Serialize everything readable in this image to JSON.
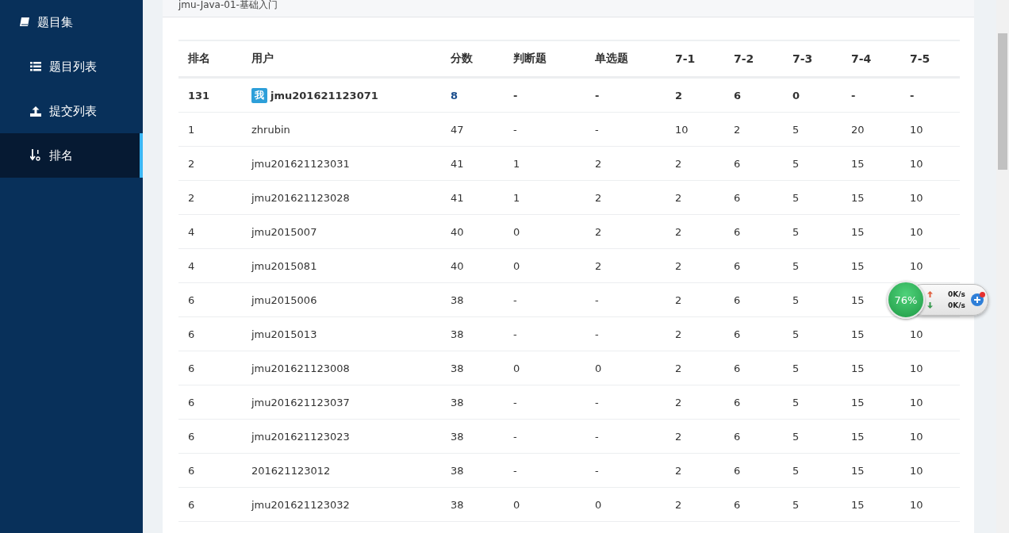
{
  "sidebar": {
    "title": "题目集",
    "items": [
      {
        "label": "题目列表",
        "kind": "list",
        "selected": false
      },
      {
        "label": "提交列表",
        "kind": "upload",
        "selected": false
      },
      {
        "label": "排名",
        "kind": "sort",
        "selected": true
      }
    ]
  },
  "page_title": "jmu-Java-01-基础入门",
  "table": {
    "columns": [
      "排名",
      "用户",
      "分数",
      "判断题",
      "单选题",
      "7-1",
      "7-2",
      "7-3",
      "7-4",
      "7-5"
    ],
    "rows": [
      {
        "self": true,
        "badge": "我",
        "cells": [
          "131",
          "jmu201621123071",
          "8",
          "-",
          "-",
          "2",
          "6",
          "0",
          "-",
          "-"
        ]
      },
      {
        "self": false,
        "cells": [
          "1",
          "zhrubin",
          "47",
          "-",
          "-",
          "10",
          "2",
          "5",
          "20",
          "10"
        ]
      },
      {
        "self": false,
        "cells": [
          "2",
          "jmu201621123031",
          "41",
          "1",
          "2",
          "2",
          "6",
          "5",
          "15",
          "10"
        ]
      },
      {
        "self": false,
        "cells": [
          "2",
          "jmu201621123028",
          "41",
          "1",
          "2",
          "2",
          "6",
          "5",
          "15",
          "10"
        ]
      },
      {
        "self": false,
        "cells": [
          "4",
          "jmu2015007",
          "40",
          "0",
          "2",
          "2",
          "6",
          "5",
          "15",
          "10"
        ]
      },
      {
        "self": false,
        "cells": [
          "4",
          "jmu2015081",
          "40",
          "0",
          "2",
          "2",
          "6",
          "5",
          "15",
          "10"
        ]
      },
      {
        "self": false,
        "cells": [
          "6",
          "jmu2015006",
          "38",
          "-",
          "-",
          "2",
          "6",
          "5",
          "15"
        ]
      },
      {
        "self": false,
        "cells": [
          "6",
          "jmu2015013",
          "38",
          "-",
          "-",
          "2",
          "6",
          "5",
          "15",
          "10"
        ]
      },
      {
        "self": false,
        "cells": [
          "6",
          "jmu201621123008",
          "38",
          "0",
          "0",
          "2",
          "6",
          "5",
          "15",
          "10"
        ]
      },
      {
        "self": false,
        "cells": [
          "6",
          "jmu201621123037",
          "38",
          "-",
          "-",
          "2",
          "6",
          "5",
          "15",
          "10"
        ]
      },
      {
        "self": false,
        "cells": [
          "6",
          "jmu201621123023",
          "38",
          "-",
          "-",
          "2",
          "6",
          "5",
          "15",
          "10"
        ]
      },
      {
        "self": false,
        "cells": [
          "6",
          "201621123012",
          "38",
          "-",
          "-",
          "2",
          "6",
          "5",
          "15",
          "10"
        ]
      },
      {
        "self": false,
        "cells": [
          "6",
          "jmu201621123032",
          "38",
          "0",
          "0",
          "2",
          "6",
          "5",
          "15",
          "10"
        ]
      }
    ]
  },
  "speed_widget": {
    "percent": "76%",
    "upload": "0K/s",
    "download": "0K/s"
  }
}
